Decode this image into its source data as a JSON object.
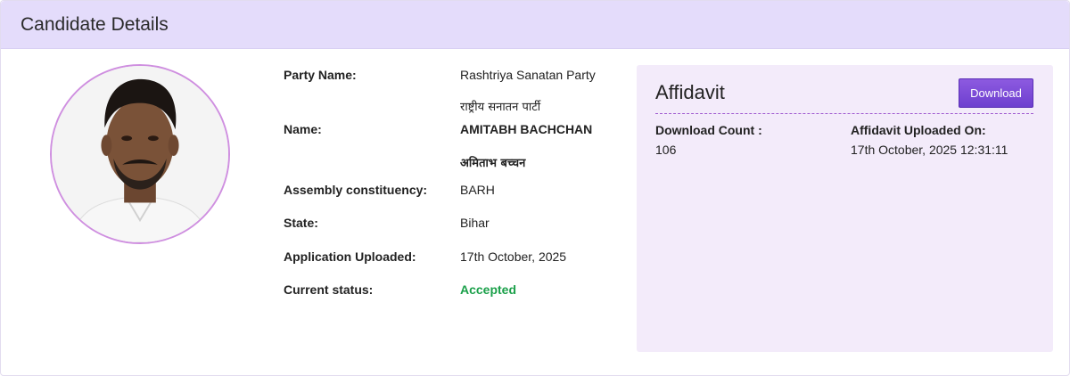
{
  "header": {
    "title": "Candidate Details"
  },
  "candidate": {
    "party_label": "Party Name:",
    "party_value": "Rashtriya Sanatan Party",
    "party_value_hindi": "राष्ट्रीय सनातन पार्टी",
    "name_label": "Name:",
    "name_value": "AMITABH BACHCHAN",
    "name_value_hindi": "अमिताभ बच्चन",
    "constituency_label": "Assembly constituency:",
    "constituency_value": "BARH",
    "state_label": "State:",
    "state_value": "Bihar",
    "uploaded_label": "Application Uploaded:",
    "uploaded_value": "17th October, 2025",
    "status_label": "Current status:",
    "status_value": "Accepted",
    "status_color": "#1ba04a"
  },
  "affidavit": {
    "title": "Affidavit",
    "download_label": "Download",
    "download_count_label": "Download Count :",
    "download_count_value": "106",
    "uploaded_on_label": "Affidavit Uploaded On:",
    "uploaded_on_value": "17th October, 2025 12:31:11"
  },
  "colors": {
    "header_bg": "#e4dcfb",
    "panel_bg": "#f3ebfa",
    "accent": "#6d3fcf"
  }
}
